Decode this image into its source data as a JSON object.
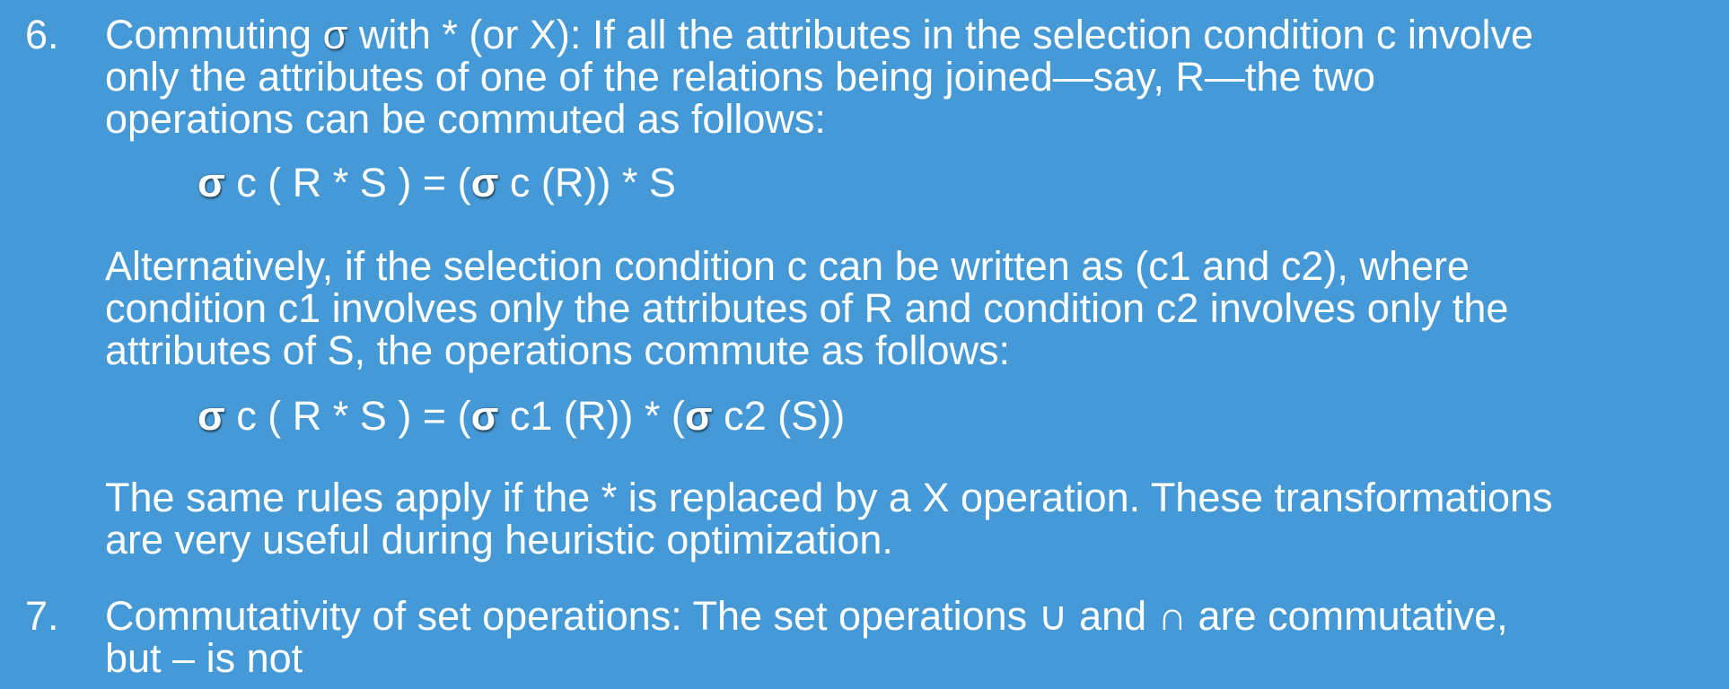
{
  "item6": {
    "number": "6.",
    "lead": "Commuting ",
    "sigma": "σ",
    "line1_rest": " with  * (or X): If all the attributes in the selection condition c involve",
    "line2": "only the attributes of one of the relations being joined—say, R—the two",
    "line3": "operations can be commuted as follows:",
    "formula1": {
      "sigma_a": "σ",
      "part_a": " c ( R * S ) = (",
      "sigma_b": "σ",
      "part_b": " c (R)) * S"
    },
    "alt_line1": "Alternatively, if the selection condition c can be written as (c1 and c2), where",
    "alt_line2": "condition c1 involves only the attributes of R and condition c2 involves only the",
    "alt_line3": "attributes of S, the operations commute as follows:",
    "formula2": {
      "sigma_a": "σ",
      "part_a": " c ( R * S ) = (",
      "sigma_b": "σ",
      "part_b": " c1 (R)) * (",
      "sigma_c": "σ",
      "part_c": " c2 (S))"
    },
    "same_line1": "The same rules apply if the * is replaced by a X operation. These transformations",
    "same_line2": "are very useful during heuristic optimization."
  },
  "item7": {
    "number": "7.",
    "line1": "Commutativity of set operations: The set operations ∪ and ∩ are commutative,",
    "line2": "but – is not"
  },
  "colors": {
    "background": "#4499d6",
    "text": "#ffffff"
  }
}
